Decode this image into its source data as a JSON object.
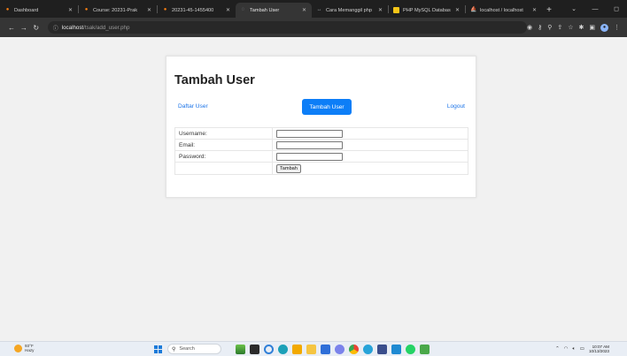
{
  "browser": {
    "tabs": [
      {
        "label": "Dashboard",
        "icon": "moodle-icon",
        "color": "#f98012",
        "active": false
      },
      {
        "label": "Course: 20231-Prak",
        "icon": "moodle-icon",
        "color": "#f98012",
        "active": false
      },
      {
        "label": "20231-45-1455400",
        "icon": "moodle-icon",
        "color": "#f98012",
        "active": false
      },
      {
        "label": "Tambah User",
        "icon": "globe-icon",
        "color": "#9aa0a6",
        "active": true
      },
      {
        "label": "Cara Memanggil php",
        "icon": "link-icon",
        "color": "#9aa0a6",
        "active": false
      },
      {
        "label": "PHP MySQL Databas",
        "icon": "w3schools-icon",
        "color": "#f5c518",
        "active": false
      },
      {
        "label": "localhost / localhost",
        "icon": "phpmyadmin-icon",
        "color": "#f0a030",
        "active": false
      }
    ],
    "url": {
      "host": "localhost",
      "path": "/tsak/add_user.php"
    }
  },
  "page": {
    "title": "Tambah User",
    "nav": {
      "left_link": "Daftar User",
      "center_button": "Tambah User",
      "right_link": "Logout"
    },
    "form": {
      "fields": [
        {
          "label": "Username:"
        },
        {
          "label": "Email:"
        },
        {
          "label": "Password:"
        }
      ],
      "submit_label": "Tambah"
    }
  },
  "taskbar": {
    "weather": {
      "temp": "93°F",
      "condition": "Hazy"
    },
    "search_placeholder": "Search",
    "time": "10:07 AM",
    "date": "10/13/2023"
  }
}
